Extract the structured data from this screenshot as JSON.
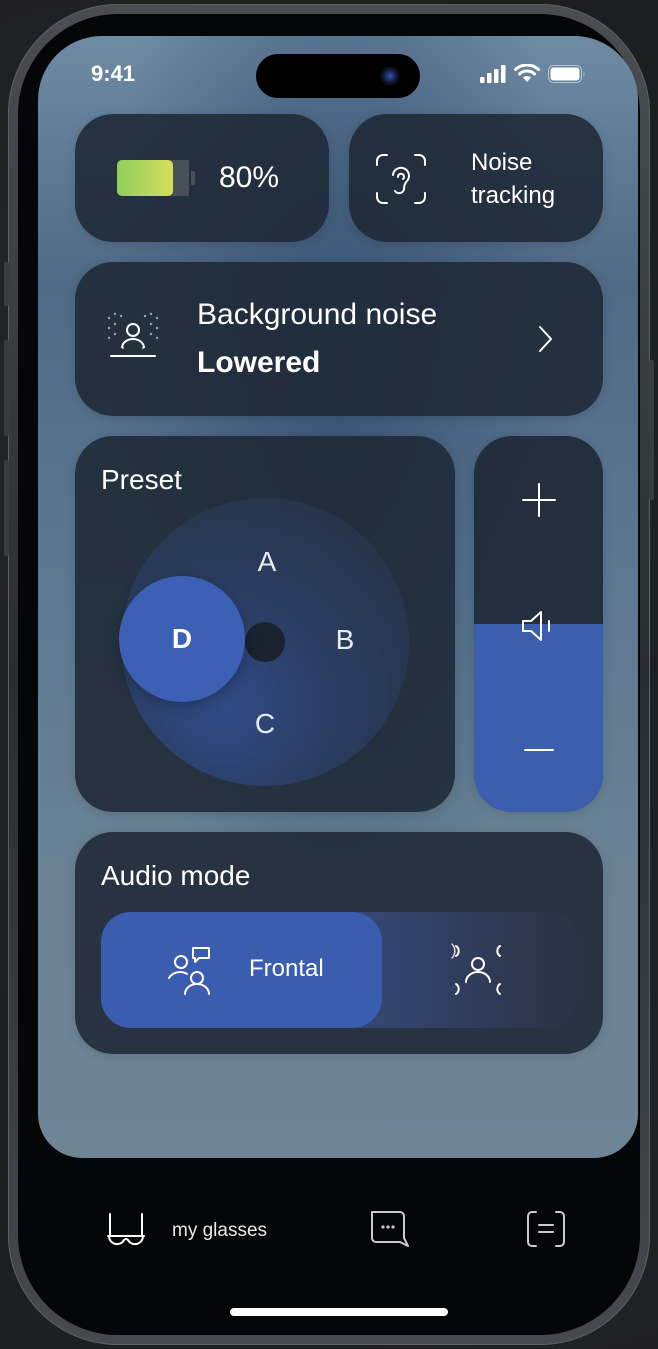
{
  "status_bar": {
    "time": "9:41"
  },
  "battery": {
    "level_percent": 80,
    "label": "80%"
  },
  "noise_tracking": {
    "label_line1": "Noise",
    "label_line2": "tracking"
  },
  "background_noise": {
    "label": "Background noise",
    "value": "Lowered"
  },
  "preset": {
    "title": "Preset",
    "options": [
      "A",
      "B",
      "C",
      "D"
    ],
    "selected": "D"
  },
  "volume": {
    "level_fraction": 0.5
  },
  "audio_mode": {
    "title": "Audio mode",
    "selected_label": "Frontal",
    "options": [
      "Frontal",
      "Surround"
    ]
  },
  "tab_bar": {
    "active_label": "my glasses"
  },
  "colors": {
    "accent": "#3b5db0",
    "card": "#1e2834",
    "battery_green": "#a6d65c"
  },
  "icons": [
    "signal-icon",
    "wifi-icon",
    "battery-status-icon",
    "battery-icon",
    "ear-icon",
    "background-noise-icon",
    "chevron-right-icon",
    "plus-icon",
    "speaker-icon",
    "minus-icon",
    "frontal-mode-icon",
    "surround-mode-icon",
    "glasses-icon",
    "chat-icon",
    "menu-icon"
  ]
}
